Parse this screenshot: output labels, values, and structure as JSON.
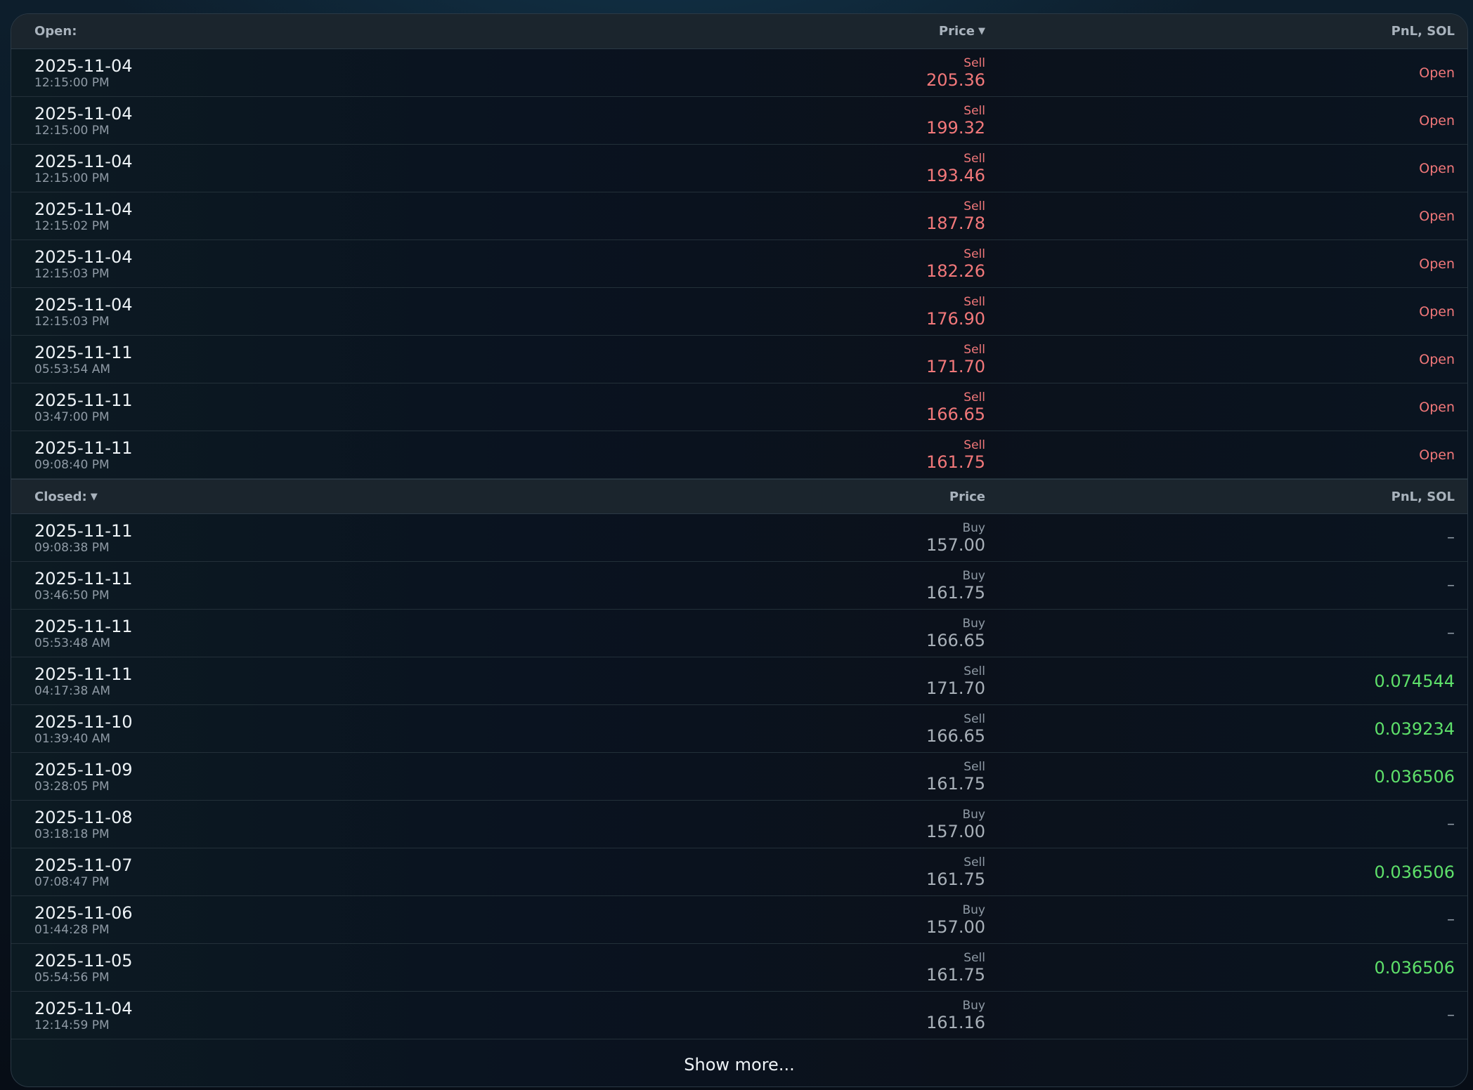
{
  "open_section": {
    "label": "Open:",
    "price_header": "Price",
    "pnl_header": "PnL, SOL",
    "rows": [
      {
        "date": "2025-11-04",
        "time": "12:15:00 PM",
        "side": "Sell",
        "price": "205.36",
        "pnl": "Open"
      },
      {
        "date": "2025-11-04",
        "time": "12:15:00 PM",
        "side": "Sell",
        "price": "199.32",
        "pnl": "Open"
      },
      {
        "date": "2025-11-04",
        "time": "12:15:00 PM",
        "side": "Sell",
        "price": "193.46",
        "pnl": "Open"
      },
      {
        "date": "2025-11-04",
        "time": "12:15:02 PM",
        "side": "Sell",
        "price": "187.78",
        "pnl": "Open"
      },
      {
        "date": "2025-11-04",
        "time": "12:15:03 PM",
        "side": "Sell",
        "price": "182.26",
        "pnl": "Open"
      },
      {
        "date": "2025-11-04",
        "time": "12:15:03 PM",
        "side": "Sell",
        "price": "176.90",
        "pnl": "Open"
      },
      {
        "date": "2025-11-11",
        "time": "05:53:54 AM",
        "side": "Sell",
        "price": "171.70",
        "pnl": "Open"
      },
      {
        "date": "2025-11-11",
        "time": "03:47:00 PM",
        "side": "Sell",
        "price": "166.65",
        "pnl": "Open"
      },
      {
        "date": "2025-11-11",
        "time": "09:08:40 PM",
        "side": "Sell",
        "price": "161.75",
        "pnl": "Open"
      }
    ]
  },
  "closed_section": {
    "label": "Closed:",
    "price_header": "Price",
    "pnl_header": "PnL, SOL",
    "rows": [
      {
        "date": "2025-11-11",
        "time": "09:08:38 PM",
        "side": "Buy",
        "price": "157.00",
        "pnl": "–"
      },
      {
        "date": "2025-11-11",
        "time": "03:46:50 PM",
        "side": "Buy",
        "price": "161.75",
        "pnl": "–"
      },
      {
        "date": "2025-11-11",
        "time": "05:53:48 AM",
        "side": "Buy",
        "price": "166.65",
        "pnl": "–"
      },
      {
        "date": "2025-11-11",
        "time": "04:17:38 AM",
        "side": "Sell",
        "price": "171.70",
        "pnl": "0.074544"
      },
      {
        "date": "2025-11-10",
        "time": "01:39:40 AM",
        "side": "Sell",
        "price": "166.65",
        "pnl": "0.039234"
      },
      {
        "date": "2025-11-09",
        "time": "03:28:05 PM",
        "side": "Sell",
        "price": "161.75",
        "pnl": "0.036506"
      },
      {
        "date": "2025-11-08",
        "time": "03:18:18 PM",
        "side": "Buy",
        "price": "157.00",
        "pnl": "–"
      },
      {
        "date": "2025-11-07",
        "time": "07:08:47 PM",
        "side": "Sell",
        "price": "161.75",
        "pnl": "0.036506"
      },
      {
        "date": "2025-11-06",
        "time": "01:44:28 PM",
        "side": "Buy",
        "price": "157.00",
        "pnl": "–"
      },
      {
        "date": "2025-11-05",
        "time": "05:54:56 PM",
        "side": "Sell",
        "price": "161.75",
        "pnl": "0.036506"
      },
      {
        "date": "2025-11-04",
        "time": "12:14:59 PM",
        "side": "Buy",
        "price": "161.16",
        "pnl": "–"
      }
    ]
  },
  "show_more_label": "Show more...",
  "icons": {
    "sort_arrow": "chevron-down-icon"
  },
  "colors": {
    "sell_red": "#f2787a",
    "profit_green": "#5ee06a",
    "muted": "#8f9aa5"
  }
}
